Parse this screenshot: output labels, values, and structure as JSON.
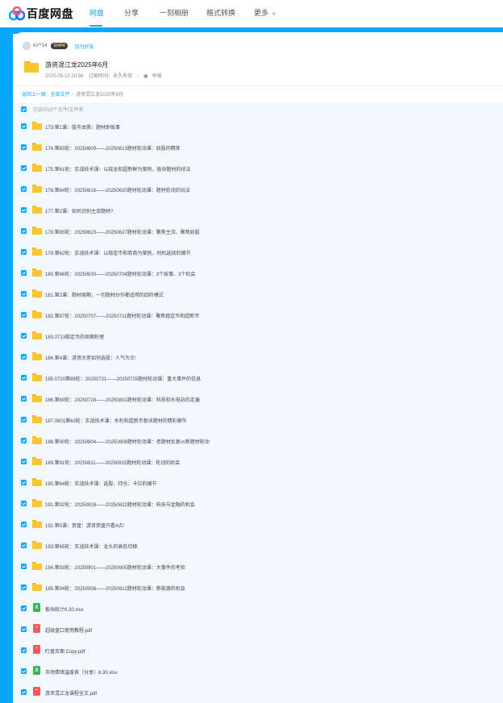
{
  "app": {
    "logo_text": "百度网盘",
    "brand_color": "#06a7ff"
  },
  "nav": {
    "items": [
      {
        "label": "网盘",
        "active": true
      },
      {
        "label": "分享",
        "active": false
      },
      {
        "label": "一刻相册",
        "active": false
      },
      {
        "label": "格式转换",
        "active": false
      },
      {
        "label": "更多",
        "active": false
      }
    ]
  },
  "share": {
    "username": "ks**14",
    "badge": "SVIP4",
    "add_friend": "加为好友",
    "title": "游资混江龙2025年6月",
    "date": "2025-09-10 20:56",
    "expire_label": "过期时间：",
    "expire_value": "永久有效",
    "report": "举报"
  },
  "breadcrumb": {
    "back": "返回上一级",
    "all": "全部文件",
    "current": "游资混江龙2025年6月"
  },
  "selection": {
    "summary": "已选中28个文件/文件夹"
  },
  "files": [
    {
      "name": "173.第1课：股市本质：题材即故事",
      "type": "folder"
    },
    {
      "name": "174.第83轮：20250609——20250613题材轮动课：妖股的精炼",
      "type": "folder"
    },
    {
      "name": "175.第61轮：实战技术课：以接龙和超新鲜为案例，板块题材的技法",
      "type": "folder"
    },
    {
      "name": "176.第84轮：20250616——20250620题材轮动课：题材轮动的玩法",
      "type": "folder"
    },
    {
      "name": "177.第2课：如何识别主流题材?",
      "type": "folder"
    },
    {
      "name": "178.第85轮：20250623——20250627题材轮动课：聚焦主流、聚焦妖股",
      "type": "folder"
    },
    {
      "name": "179.第62轮：实战技术课：以稳定币和券商为案例，时机选择的细节",
      "type": "folder"
    },
    {
      "name": "180.第86轮：20250630——20250704题材轮动课：3个故事、3个机会",
      "type": "folder"
    },
    {
      "name": "181.第3课：题材周期，一切题材炒作都适用的四阶模式",
      "type": "folder"
    },
    {
      "name": "182.第87轮：20250707——20250711题材轮动课：聚焦稳定币和超新币",
      "type": "folder"
    },
    {
      "name": "183.0713稳定币的周期轮理",
      "type": "folder"
    },
    {
      "name": "184.第4课：游资大佬如何选股：人气为王!",
      "type": "folder"
    },
    {
      "name": "185.0720第88轮：20250721——20250725题材轮动课：重大事件的信息",
      "type": "folder"
    },
    {
      "name": "186.第89轮：20250728——20250801题材轮动课：科技和水电站的走遍",
      "type": "folder"
    },
    {
      "name": "187.0801第63轮：实战技术课：水利和超新币板块题材的精彩细节",
      "type": "folder"
    },
    {
      "name": "188.第90轮：20250804——20250808题材轮动课：老题材反复vs新题材轮动",
      "type": "folder"
    },
    {
      "name": "189.第91轮：20250811——20250815题材轮动课：轮动的机会",
      "type": "folder"
    },
    {
      "name": "190.第64轮：实战技术课：选股、持仓、卡位的细节",
      "type": "folder"
    },
    {
      "name": "191.第92轮：20250818——20250822题材轮动课：科技与金融的机会",
      "type": "folder"
    },
    {
      "name": "192.第5课：赏盘：游资赏盘只看4点!",
      "type": "folder"
    },
    {
      "name": "193.第65轮：实战技术课：龙头的高低切换",
      "type": "folder"
    },
    {
      "name": "194.第93轮：20250901——20250905题材轮动课：大事件的考验",
      "type": "folder"
    },
    {
      "name": "195.第94轮：20250908——20250912题材轮动课：新能源的机会",
      "type": "folder"
    },
    {
      "name": "板块统计6.30.xlsx",
      "type": "xlsx"
    },
    {
      "name": "超级盘口使用教程.pdf",
      "type": "pdf"
    },
    {
      "name": "盯盘页面 Copy.pdf",
      "type": "pdf"
    },
    {
      "name": "市场情绪温度表（分享）6.30.xlsx",
      "type": "xlsx"
    },
    {
      "name": "游资混江龙课程全文.pdf",
      "type": "pdf"
    }
  ]
}
